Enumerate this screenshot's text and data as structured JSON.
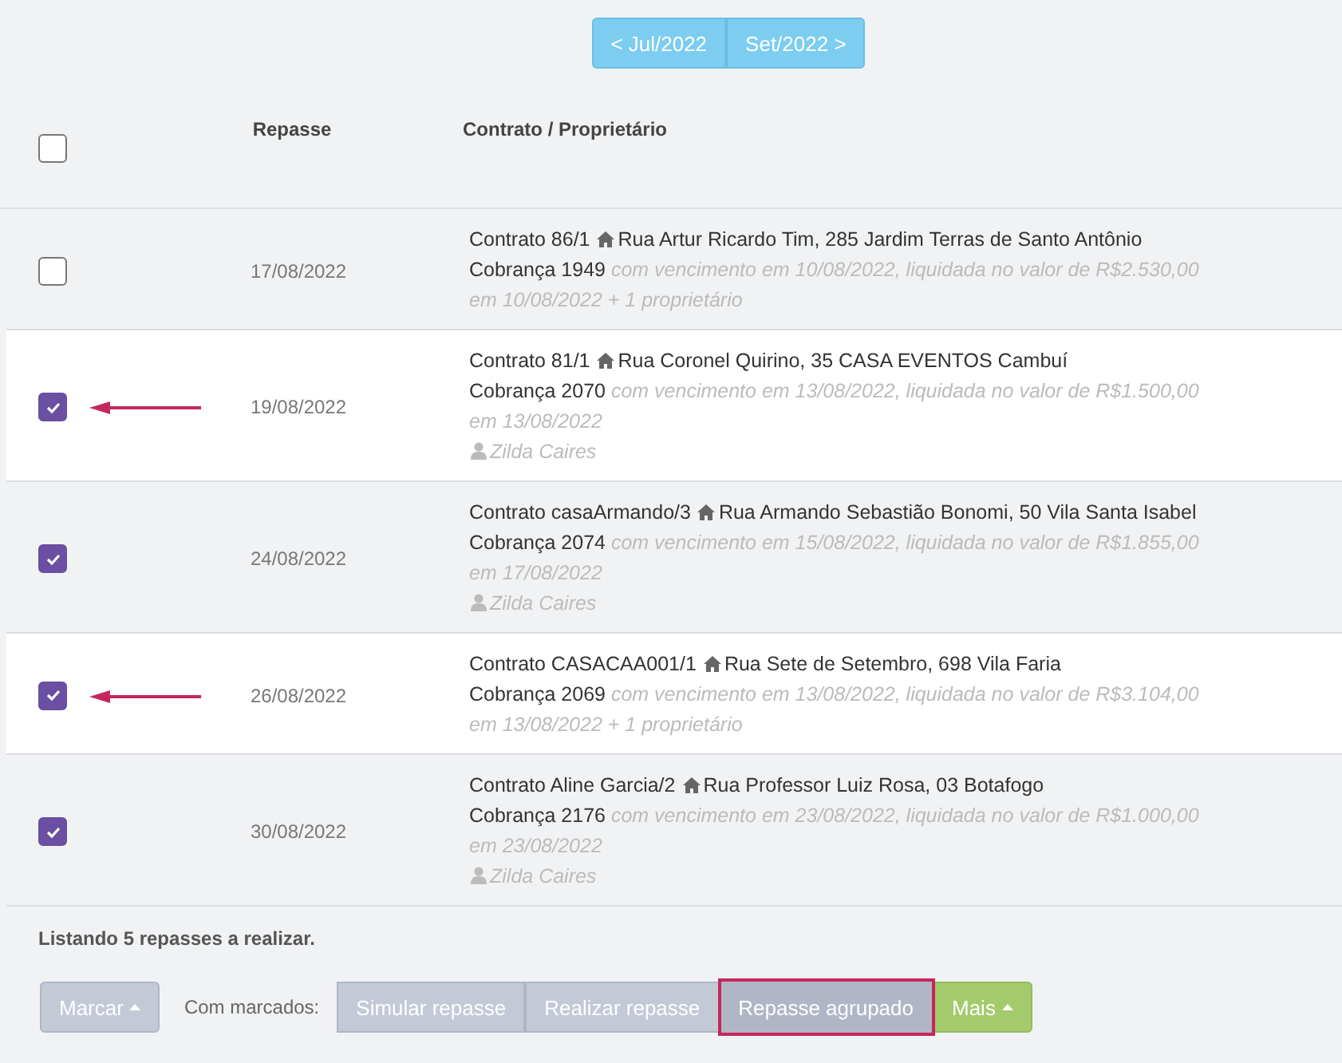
{
  "pager": {
    "previous": "< Jul/2022",
    "next": "Set/2022 >"
  },
  "table": {
    "header_checked": false,
    "columns": [
      "Repasse",
      "Contrato / Proprietário"
    ],
    "rows": [
      {
        "checked": false,
        "highlighted": false,
        "date": "17/08/2022",
        "contract": "Contrato 86/1",
        "address": "Rua Artur Ricardo Tim, 285 Jardim Terras de Santo Antônio",
        "charge": "Cobrança 1949",
        "detail": "com vencimento em 10/08/2022, liquidada no valor de R$2.530,00 em 10/08/2022 + 1 proprietário"
      },
      {
        "checked": true,
        "highlighted": true,
        "date": "19/08/2022",
        "contract": "Contrato 81/1",
        "address": "Rua Coronel Quirino, 35 CASA EVENTOS Cambuí",
        "charge": "Cobrança 2070",
        "detail": "com vencimento em 13/08/2022, liquidada no valor de R$1.500,00 em 13/08/2022",
        "owner": "Zilda Caires"
      },
      {
        "checked": true,
        "highlighted": false,
        "date": "24/08/2022",
        "contract": "Contrato casaArmando/3",
        "address": "Rua Armando Sebastião Bonomi, 50 Vila Santa Isabel",
        "charge": "Cobrança 2074",
        "detail": "com vencimento em 15/08/2022, liquidada no valor de R$1.855,00 em 17/08/2022",
        "owner": "Zilda Caires"
      },
      {
        "checked": true,
        "highlighted": true,
        "date": "26/08/2022",
        "contract": "Contrato CASACAA001/1",
        "address": "Rua Sete de Setembro, 698 Vila Faria",
        "charge": "Cobrança 2069",
        "detail": "com vencimento em 13/08/2022, liquidada no valor de R$3.104,00 em 13/08/2022 + 1 proprietário"
      },
      {
        "checked": true,
        "highlighted": false,
        "date": "30/08/2022",
        "contract": "Contrato Aline Garcia/2",
        "address": "Rua Professor Luiz Rosa, 03 Botafogo",
        "charge": "Cobrança 2176",
        "detail": "com vencimento em 23/08/2022, liquidada no valor de R$1.000,00 em 23/08/2022",
        "owner": "Zilda Caires"
      }
    ]
  },
  "summary": "Listando 5 repasses a realizar.",
  "toolbar": {
    "mark_button": "Marcar",
    "label": "Com marcados:",
    "actions": [
      {
        "label": "Simular repasse",
        "highlighted": false
      },
      {
        "label": "Realizar repasse",
        "highlighted": false
      },
      {
        "label": "Repasse agrupado",
        "highlighted": true
      }
    ],
    "more_button": "Mais"
  }
}
